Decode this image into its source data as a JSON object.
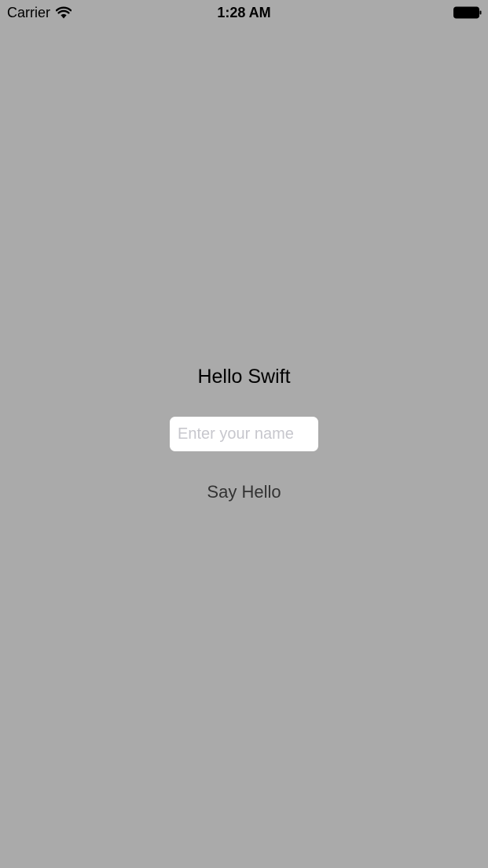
{
  "status_bar": {
    "carrier": "Carrier",
    "time": "1:28 AM",
    "wifi_icon": "wifi-icon",
    "battery_icon": "battery-icon"
  },
  "main": {
    "title": "Hello Swift",
    "name_input": {
      "value": "",
      "placeholder": "Enter your name"
    },
    "say_hello_label": "Say Hello"
  },
  "colors": {
    "background": "#aaaaaa",
    "input_background": "#ffffff",
    "placeholder_text": "#c7c7cd",
    "button_text": "#333333"
  }
}
